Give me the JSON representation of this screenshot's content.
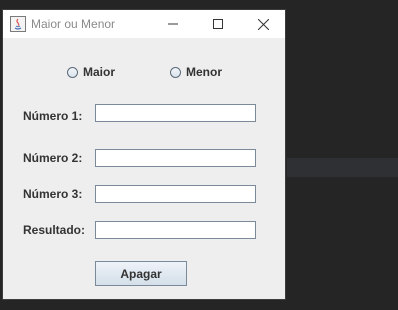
{
  "window": {
    "title": "Maior ou Menor"
  },
  "options": {
    "maior": "Maior",
    "menor": "Menor"
  },
  "fields": {
    "numero1": {
      "label": "Número 1:",
      "value": ""
    },
    "numero2": {
      "label": "Número 2:",
      "value": ""
    },
    "numero3": {
      "label": "Número 3:",
      "value": ""
    },
    "resultado": {
      "label": "Resultado:",
      "value": ""
    }
  },
  "buttons": {
    "apagar": "Apagar"
  },
  "icons": {
    "app": "java-app-icon",
    "minimize": "minimize-icon",
    "maximize": "maximize-icon",
    "close": "close-icon"
  }
}
